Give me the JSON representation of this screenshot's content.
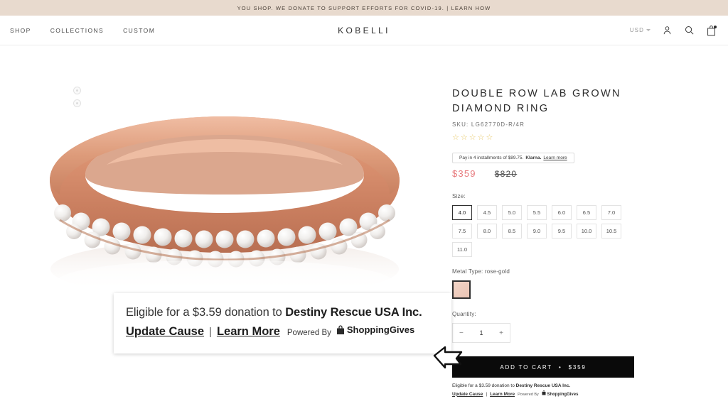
{
  "announcement": {
    "text": "YOU SHOP. WE DONATE TO SUPPORT EFFORTS FOR COVID-19.",
    "separator": "|",
    "link": "LEARN HOW",
    "bg_color": "#e8dace"
  },
  "header": {
    "brand": "KOBELLI",
    "nav": [
      {
        "label": "SHOP"
      },
      {
        "label": "COLLECTIONS"
      },
      {
        "label": "CUSTOM"
      }
    ],
    "currency": "USD",
    "icons": {
      "account": "account-icon",
      "search": "search-icon",
      "cart": "cart-icon"
    }
  },
  "product": {
    "title": "DOUBLE ROW LAB GROWN DIAMOND RING",
    "sku_label": "SKU:",
    "sku_value": "LG62770D-R/4R",
    "rating_stars": 5,
    "rating_filled": 0,
    "star_glyph": "☆",
    "star_color": "#e8c96a",
    "klarna": {
      "text": "Pay in 4 installments of $89.75.",
      "brand": "Klarna.",
      "link": "Learn more"
    },
    "price_current": "$359",
    "price_original": "$820",
    "price_color": "#e7797c",
    "size_label": "Size:",
    "sizes": [
      "4.0",
      "4.5",
      "5.0",
      "5.5",
      "6.0",
      "6.5",
      "7.0",
      "7.5",
      "8.0",
      "8.5",
      "9.0",
      "9.5",
      "10.0",
      "10.5",
      "11.0"
    ],
    "size_selected": "4.0",
    "metal_label": "Metal Type: rose-gold",
    "metal_swatch_color": "#eec9b9",
    "quantity_label": "Quantity:",
    "quantity_value": "1",
    "quantity_minus": "−",
    "quantity_plus": "+",
    "add_to_cart": "ADD TO CART",
    "add_to_cart_sep": "•",
    "add_to_cart_price": "$359"
  },
  "shoppinggives_widget": {
    "line1_prefix": "Eligible for a $3.59 donation to ",
    "line1_org": "Destiny Rescue USA Inc.",
    "update_cause": "Update Cause",
    "separator": "|",
    "learn_more": "Learn More",
    "powered_by": "Powered By",
    "logo_text": "ShoppingGives"
  },
  "callout": {
    "line1_prefix": "Eligible for a $3.59 donation to ",
    "line1_org": "Destiny Rescue USA Inc.",
    "update_cause": "Update Cause",
    "separator": "|",
    "learn_more": "Learn More",
    "powered_by": "Powered By",
    "logo_text": "ShoppingGives"
  },
  "gallery": {
    "thumbnail_count": 2,
    "product_image_alt": "rose gold double row pave diamond ring"
  }
}
